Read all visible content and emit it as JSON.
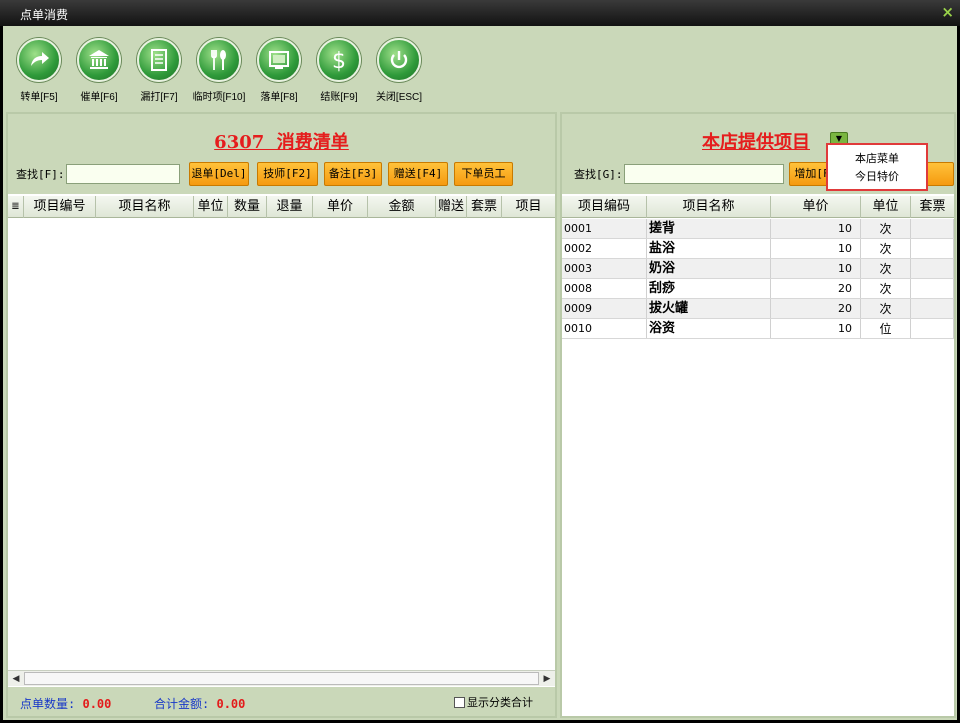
{
  "window": {
    "title": "点单消费",
    "close_glyph": "×"
  },
  "toolbar": [
    {
      "icon": "forward-arrow-icon",
      "label": "转单[F5]"
    },
    {
      "icon": "bank-icon",
      "label": "催单[F6]"
    },
    {
      "icon": "document-icon",
      "label": "漏打[F7]"
    },
    {
      "icon": "fork-spoon-icon",
      "label": "临时项[F10]"
    },
    {
      "icon": "screen-icon",
      "label": "落单[F8]"
    },
    {
      "icon": "dollar-icon",
      "label": "结账[F9]"
    },
    {
      "icon": "power-icon",
      "label": "关闭[ESC]"
    }
  ],
  "left_panel": {
    "title": "6307  消费清单",
    "search_label": "查找[F]:",
    "search_value": "",
    "buttons": [
      "退单[Del]",
      "技师[F2]",
      "备注[F3]",
      "赠送[F4]",
      "下单员工"
    ],
    "columns": [
      "项目编号",
      "项目名称",
      "单位",
      "数量",
      "退量",
      "单价",
      "金额",
      "赠送",
      "套票",
      "项目"
    ],
    "row_icon": "list-icon",
    "footer": {
      "count_label": "点单数量:",
      "count_value": "0.00",
      "total_label": "合计金额:",
      "total_value": "0.00",
      "checkbox_label": "显示分类合计"
    }
  },
  "right_panel": {
    "title": "本店提供项目",
    "search_label": "查找[G]:",
    "search_value": "",
    "add_button": "增加[F",
    "columns": [
      "项目编码",
      "项目名称",
      "单价",
      "单位",
      "套票"
    ],
    "rows": [
      {
        "code": "0001",
        "name": "搓背",
        "price": "10",
        "unit": "次"
      },
      {
        "code": "0002",
        "name": "盐浴",
        "price": "10",
        "unit": "次"
      },
      {
        "code": "0003",
        "name": "奶浴",
        "price": "10",
        "unit": "次"
      },
      {
        "code": "0008",
        "name": "刮痧",
        "price": "20",
        "unit": "次"
      },
      {
        "code": "0009",
        "name": "拔火罐",
        "price": "20",
        "unit": "次"
      },
      {
        "code": "0010",
        "name": "浴资",
        "price": "10",
        "unit": "位"
      }
    ],
    "dropdown_options": [
      "本店菜单",
      "今日特价"
    ]
  },
  "colors": {
    "accent_red": "#e51d1d",
    "panel_green": "#cad8b9",
    "button_orange": "#f59a10",
    "label_blue": "#1838c8"
  }
}
